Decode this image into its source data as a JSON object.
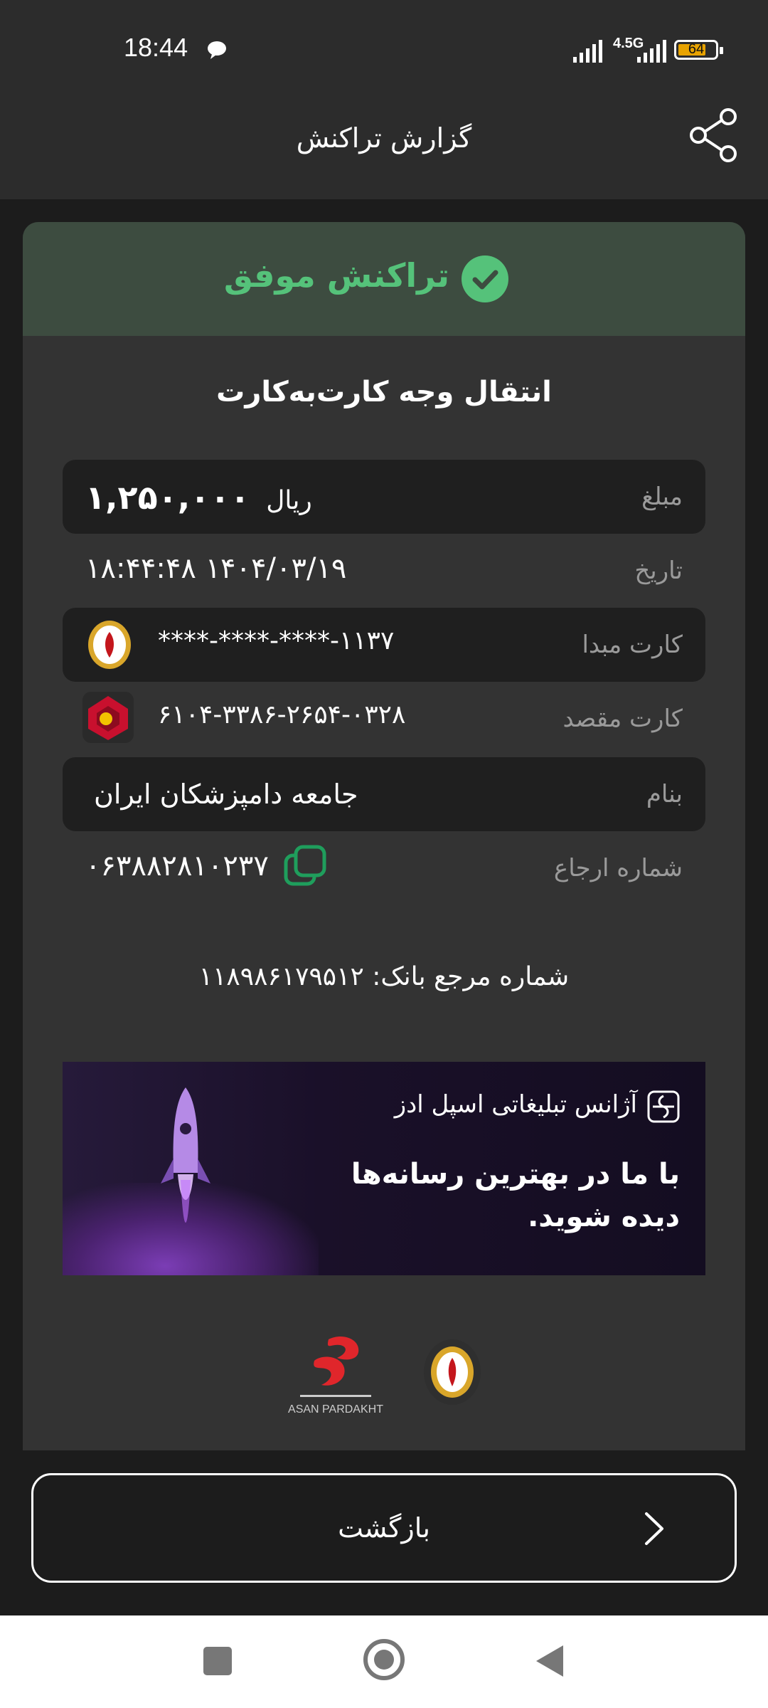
{
  "status_bar": {
    "time": "18:44",
    "network": "4.5G",
    "battery": "64"
  },
  "header": {
    "title": "گزارش تراکنش"
  },
  "receipt": {
    "status": "تراکنش موفق",
    "type": "انتقال وجه کارت‌به‌کارت",
    "rows": [
      {
        "label": "مبلغ",
        "value": "۱,۲۵۰,۰۰۰",
        "unit": "ریال"
      },
      {
        "label": "تاریخ",
        "value": "۱۸:۴۴:۴۸ ۱۴۰۴/۰۳/۱۹"
      },
      {
        "label": "کارت مبدا",
        "value": "****-****-****-۱۱۳۷"
      },
      {
        "label": "کارت مقصد",
        "value": "۶۱۰۴-۳۳۸۶-۲۶۵۴-۰۳۲۸"
      },
      {
        "label": "بنام",
        "value": "جامعه دامپزشکان ایران"
      },
      {
        "label": "شماره ارجاع",
        "value": "۰۶۳۸۸۲۸۱۰۲۳۷"
      }
    ],
    "bank_reference": "شماره مرجع بانک: ۱۱۸۹۸۶۱۷۹۵۱۲"
  },
  "ad": {
    "agency": "آژانس تبلیغاتی اسپل ادز",
    "slogan": "با ما در بهترین رسانه‌ها دیده شوید."
  },
  "logos": {
    "asan_pardakht_label": "ASAN PARDAKHT"
  },
  "back_button": {
    "label": "بازگشت"
  },
  "colors": {
    "success": "#55c27a",
    "banner_bg": "#3d4c40",
    "card_bg": "#333333",
    "row_bg": "#1f1f1f"
  },
  "icons": [
    "chat-icon",
    "share-icon",
    "check-circle-icon",
    "bank-melli-logo",
    "bank-mellat-logo",
    "copy-icon",
    "spell-ads-logo",
    "asan-pardakht-logo",
    "chevron-right-icon",
    "square-nav-icon",
    "home-circle-icon",
    "back-triangle-icon"
  ]
}
